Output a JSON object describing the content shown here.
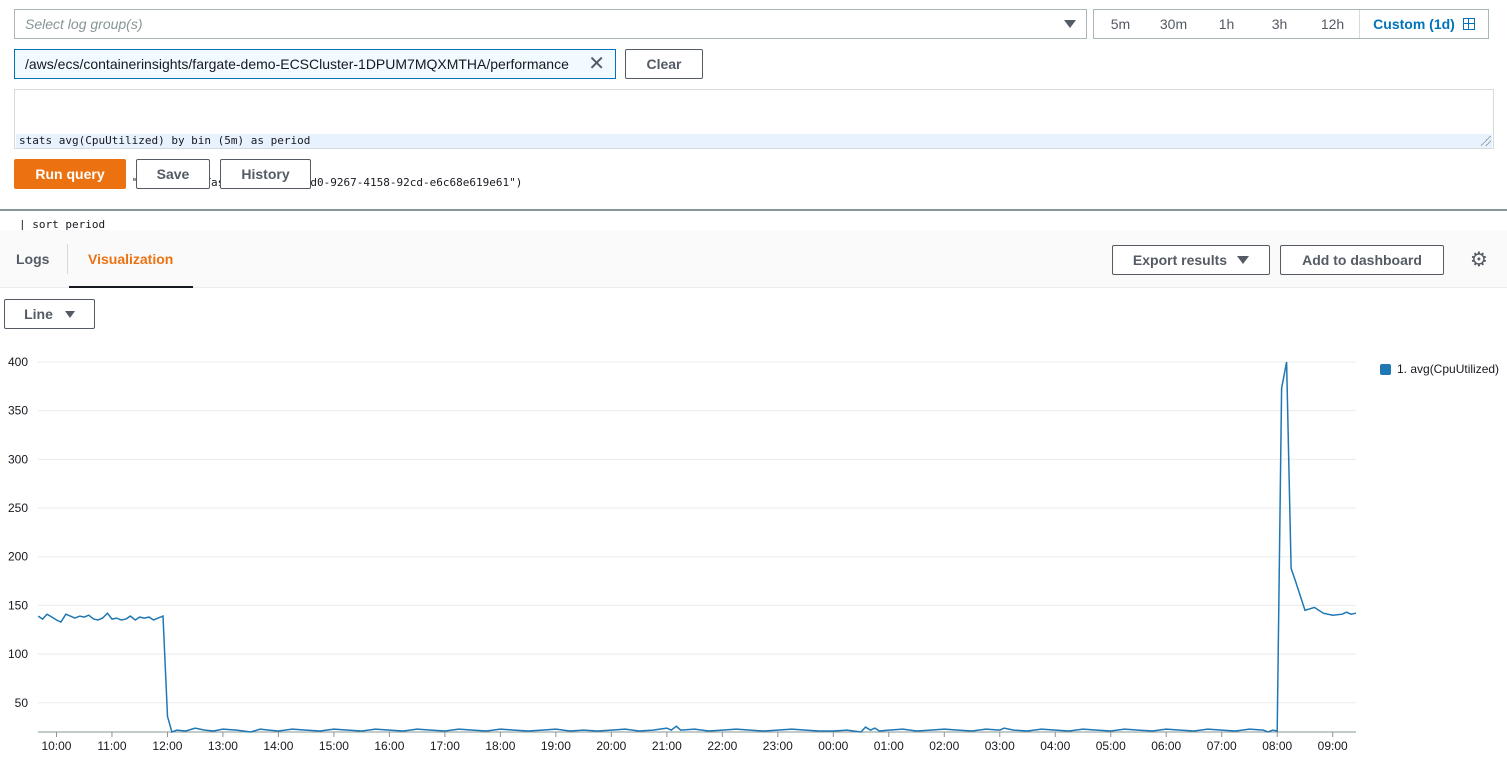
{
  "query_bar": {
    "log_group_placeholder": "Select log group(s)",
    "selected_log_group": "/aws/ecs/containerinsights/fargate-demo-ECSCluster-1DPUM7MQXMTHA/performance",
    "clear_label": "Clear",
    "time_ranges": [
      "5m",
      "30m",
      "1h",
      "3h",
      "12h"
    ],
    "custom_range": "Custom (1d)"
  },
  "editor": {
    "lines": [
      "stats avg(CpuUtilized) by bin (5m) as period",
      "| filter (Type = \"Task\" and TaskId = \"97fe0bd0-9267-4158-92cd-e6c68e619e61\")",
      "| sort period"
    ]
  },
  "actions": {
    "run_query": "Run query",
    "save": "Save",
    "history": "History"
  },
  "results": {
    "tabs": [
      "Logs",
      "Visualization"
    ],
    "active_tab": "Visualization",
    "export_label": "Export results",
    "add_dashboard_label": "Add to dashboard",
    "chart_type_label": "Line"
  },
  "colors": {
    "accent": "#ec7211",
    "link": "#0073bb",
    "series": "#1f77b4"
  },
  "chart_data": {
    "type": "line",
    "title": "",
    "xlabel": "",
    "ylabel": "",
    "ylim": [
      20,
      400
    ],
    "y_ticks": [
      50,
      100,
      150,
      200,
      250,
      300,
      350,
      400
    ],
    "x_ticks": [
      "10:00",
      "11:00",
      "12:00",
      "13:00",
      "14:00",
      "15:00",
      "16:00",
      "17:00",
      "18:00",
      "19:00",
      "20:00",
      "21:00",
      "22:00",
      "23:00",
      "00:00",
      "01:00",
      "02:00",
      "03:00",
      "04:00",
      "05:00",
      "06:00",
      "07:00",
      "08:00",
      "09:00"
    ],
    "x_start": "09:40",
    "x_end": "09:25",
    "grid": true,
    "legend_position": "right",
    "series": [
      {
        "name": "1. avg(CpuUtilized)",
        "color": "#1f77b4",
        "x_hours": [
          9.67,
          9.75,
          9.83,
          9.92,
          10.0,
          10.08,
          10.17,
          10.25,
          10.33,
          10.42,
          10.5,
          10.58,
          10.67,
          10.75,
          10.83,
          10.92,
          11.0,
          11.08,
          11.17,
          11.25,
          11.33,
          11.42,
          11.5,
          11.58,
          11.67,
          11.75,
          11.83,
          11.92,
          12.0,
          12.08,
          12.17,
          12.33,
          12.5,
          12.67,
          12.83,
          13.0,
          13.25,
          13.5,
          13.67,
          13.83,
          14.0,
          14.25,
          14.5,
          14.75,
          15.0,
          15.25,
          15.5,
          15.75,
          16.0,
          16.25,
          16.5,
          16.75,
          17.0,
          17.25,
          17.5,
          17.75,
          18.0,
          18.25,
          18.5,
          18.75,
          19.0,
          19.25,
          19.5,
          19.75,
          20.0,
          20.25,
          20.5,
          20.75,
          21.0,
          21.08,
          21.17,
          21.25,
          21.5,
          21.75,
          22.0,
          22.25,
          22.5,
          22.75,
          23.0,
          23.25,
          23.5,
          23.75,
          24.0,
          24.25,
          24.5,
          24.58,
          24.67,
          24.75,
          24.83,
          25.0,
          25.25,
          25.5,
          25.75,
          26.0,
          26.25,
          26.5,
          26.75,
          27.0,
          27.08,
          27.25,
          27.5,
          27.75,
          28.0,
          28.25,
          28.5,
          28.75,
          29.0,
          29.25,
          29.5,
          29.75,
          30.0,
          30.25,
          30.5,
          30.75,
          31.0,
          31.25,
          31.5,
          31.75,
          31.83,
          31.92,
          32.0,
          32.08,
          32.17,
          32.25,
          32.33,
          32.5,
          32.67,
          32.83,
          33.0,
          33.17,
          33.25,
          33.33,
          33.42
        ],
        "values": [
          139,
          136,
          141,
          138,
          135,
          133,
          141,
          139,
          137,
          139,
          138,
          140,
          136,
          135,
          137,
          142,
          136,
          137,
          135,
          136,
          139,
          135,
          138,
          137,
          138,
          135,
          137,
          139,
          36,
          20,
          22,
          21,
          24,
          22,
          21,
          23,
          22,
          20,
          23,
          22,
          21,
          23,
          22,
          21,
          23,
          22,
          21,
          23,
          22,
          21,
          23,
          22,
          21,
          23,
          22,
          21,
          23,
          22,
          21,
          22,
          23,
          21,
          22,
          21,
          22,
          23,
          21,
          22,
          24,
          22,
          26,
          22,
          23,
          21,
          22,
          23,
          22,
          21,
          22,
          23,
          22,
          21,
          21,
          22,
          20,
          25,
          22,
          24,
          21,
          22,
          23,
          21,
          22,
          23,
          22,
          21,
          23,
          22,
          24,
          22,
          21,
          23,
          22,
          21,
          23,
          22,
          21,
          23,
          22,
          21,
          23,
          22,
          21,
          23,
          22,
          21,
          23,
          22,
          20,
          22,
          21,
          373,
          400,
          188,
          175,
          145,
          148,
          142,
          140,
          141,
          143,
          141,
          142,
          140,
          141
        ]
      }
    ]
  }
}
